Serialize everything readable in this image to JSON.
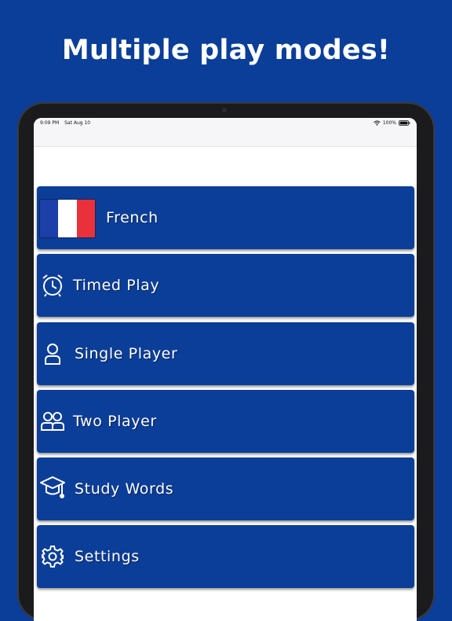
{
  "headline": "Multiple play modes!",
  "status_bar": {
    "time": "9:09 PM",
    "date": "Sat Aug 10",
    "battery": "100%"
  },
  "menu": {
    "items": [
      {
        "label": "French",
        "icon": "french-flag"
      },
      {
        "label": "Timed Play",
        "icon": "alarm-clock-icon"
      },
      {
        "label": "Single Player",
        "icon": "person-icon"
      },
      {
        "label": "Two Player",
        "icon": "two-people-icon"
      },
      {
        "label": "Study Words",
        "icon": "graduation-cap-icon"
      },
      {
        "label": "Settings",
        "icon": "gear-icon"
      }
    ]
  },
  "colors": {
    "background": "#0b3e98",
    "button": "#0b3e98",
    "flag_blue": "#1d3fa8",
    "flag_white": "#ffffff",
    "flag_red": "#e8313b"
  }
}
